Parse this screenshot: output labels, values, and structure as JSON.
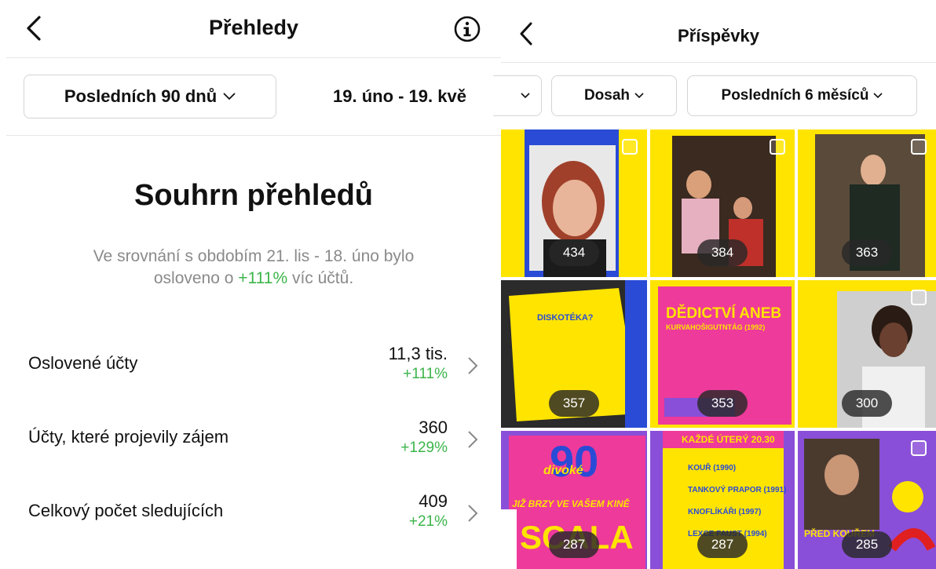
{
  "left": {
    "title": "Přehledy",
    "period_button": "Posledních 90 dnů",
    "date_range": "19. úno - 19. kvě",
    "summary_title": "Souhrn přehledů",
    "summary_line1": "Ve srovnání s obdobím 21. lis - 18. úno bylo",
    "summary_prefix": "osloveno o ",
    "summary_highlight": "+111%",
    "summary_suffix": " víc účtů.",
    "metrics": [
      {
        "label": "Oslovené účty",
        "value": "11,3 tis.",
        "change": "+111%"
      },
      {
        "label": "Účty, které projevily zájem",
        "value": "360",
        "change": "+129%"
      },
      {
        "label": "Celkový počet sledujících",
        "value": "409",
        "change": "+21%"
      }
    ]
  },
  "right": {
    "title": "Příspěvky",
    "filters": {
      "reach": "Dosah",
      "period": "Posledních 6 měsíců"
    },
    "posts": [
      {
        "count": "434"
      },
      {
        "count": "384"
      },
      {
        "count": "363"
      },
      {
        "count": "357",
        "heading": "DISKOTÉKA?"
      },
      {
        "count": "353",
        "heading": "DĚDICTVÍ ANEB",
        "subheading": "KURVAHOŠIGUTNTÁG (1992)"
      },
      {
        "count": "300"
      },
      {
        "count": "287",
        "number": "90",
        "script": "divoké",
        "tagline": "JIŽ BRZY VE VAŠEM KINĚ",
        "word": "SCALA"
      },
      {
        "count": "287",
        "heading": "KAŽDÉ ÚTERÝ 20.30",
        "films": [
          "KOUŘ (1990)",
          "TANKOVÝ PRAPOR (1991)",
          "KNOFLÍKÁŘI (1997)",
          "LEXCE FAUST (1994)"
        ]
      },
      {
        "count": "285",
        "caption": "PŘED KOUŘEM"
      }
    ]
  },
  "colors": {
    "accent_green": "#3cb54a",
    "poster_yellow": "#ffe400",
    "poster_pink": "#ee3a9a",
    "poster_blue": "#2a4bd6",
    "poster_purple": "#8a4fd8"
  }
}
